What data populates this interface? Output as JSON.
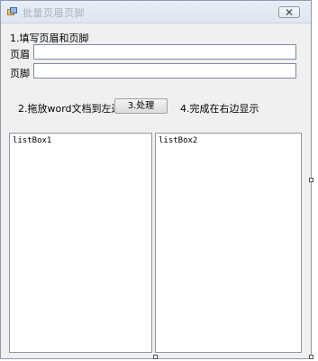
{
  "window": {
    "title": "批量页眉页脚"
  },
  "step1": {
    "label": "1.填写页眉和页脚"
  },
  "header_field": {
    "label": "页眉",
    "value": ""
  },
  "footer_field": {
    "label": "页脚",
    "value": ""
  },
  "step2": {
    "label": "2.拖放word文档到左边"
  },
  "process_button": {
    "label": "3.处理"
  },
  "step4": {
    "label": "4.完成在右边显示"
  },
  "listbox1": {
    "name": "listBox1"
  },
  "listbox2": {
    "name": "listBox2"
  },
  "colors": {
    "window_bg": "#f0f0f0",
    "border": "#8a9bb0"
  }
}
